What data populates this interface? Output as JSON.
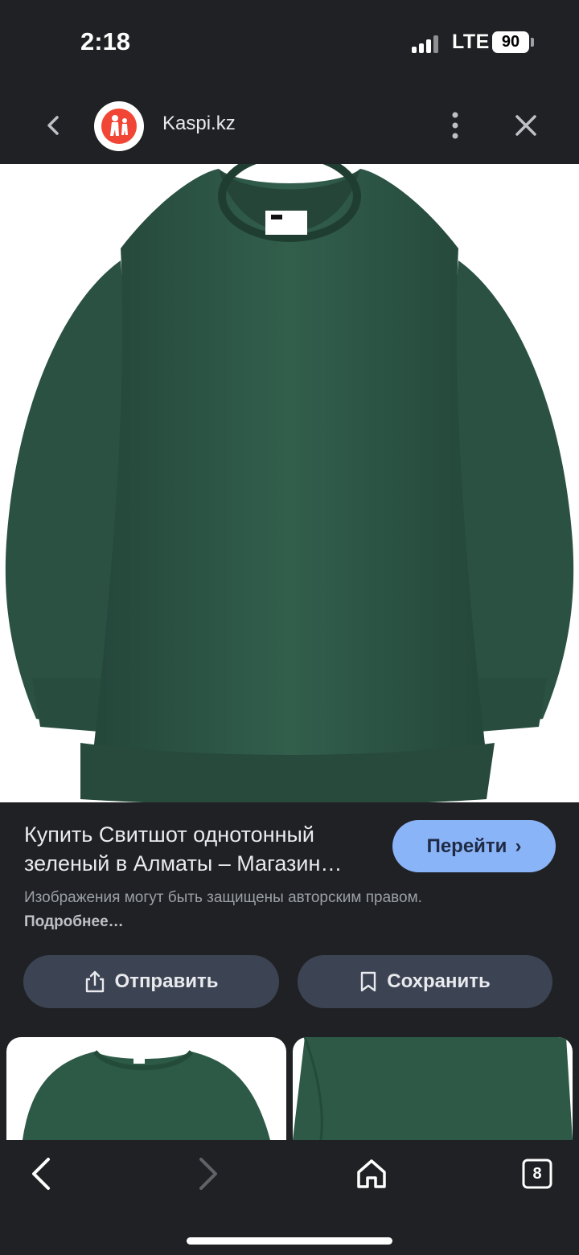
{
  "status_bar": {
    "time": "2:18",
    "network": "LTE",
    "battery": "90"
  },
  "header": {
    "site_name": "Kaspi.kz",
    "back_icon": "chevron-left-icon",
    "more_icon": "more-vertical-icon",
    "close_icon": "close-icon"
  },
  "result": {
    "title": "Купить Свитшот однотонный зеленый в Алматы – Магазин…",
    "go_button_label": "Перейти",
    "notice_text": "Изображения могут быть защищены авторским правом.",
    "notice_link": "Подробнее…",
    "share_label": "Отправить",
    "save_label": "Сохранить"
  },
  "toolbar": {
    "tab_count": "8"
  },
  "colors": {
    "background": "#202124",
    "accent": "#8ab4f8",
    "button_bg": "#3c4353",
    "sweater_green": "#2f5a47"
  }
}
